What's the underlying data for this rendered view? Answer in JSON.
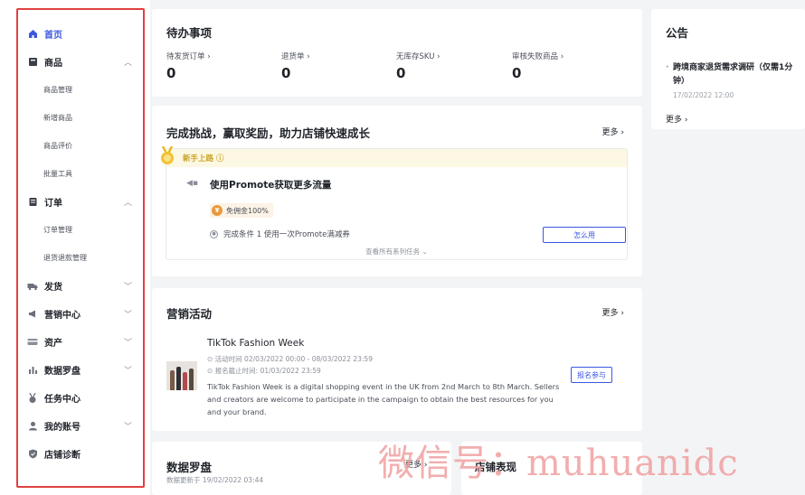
{
  "sidebar": {
    "items": [
      {
        "label": "首页",
        "icon": "home-icon",
        "active": true
      },
      {
        "label": "商品",
        "icon": "product-icon",
        "chevron": "up",
        "children": [
          "商品管理",
          "新增商品",
          "商品评价",
          "批量工具"
        ]
      },
      {
        "label": "订单",
        "icon": "order-icon",
        "chevron": "up",
        "children": [
          "订单管理",
          "退货退款管理"
        ]
      },
      {
        "label": "发货",
        "icon": "truck-icon",
        "chevron": "down"
      },
      {
        "label": "营销中心",
        "icon": "megaphone-icon",
        "chevron": "down"
      },
      {
        "label": "资产",
        "icon": "card-icon",
        "chevron": "down"
      },
      {
        "label": "数据罗盘",
        "icon": "chart-icon",
        "chevron": "down"
      },
      {
        "label": "任务中心",
        "icon": "medal-icon"
      },
      {
        "label": "我的账号",
        "icon": "user-icon",
        "chevron": "down"
      },
      {
        "label": "店铺诊断",
        "icon": "shield-icon"
      }
    ]
  },
  "todo": {
    "title": "待办事项",
    "items": [
      {
        "label": "待发货订单 ›",
        "value": "0"
      },
      {
        "label": "退货单 ›",
        "value": "0"
      },
      {
        "label": "无库存SKU ›",
        "value": "0"
      },
      {
        "label": "审核失败商品 ›",
        "value": "0"
      }
    ]
  },
  "notice": {
    "title": "公告",
    "text": "跨境商家退货需求调研（仅需1分钟）",
    "date": "17/02/2022 12:00",
    "more": "更多 ›"
  },
  "challenge": {
    "title": "完成挑战，赢取奖励，助力店铺快速成长",
    "more": "更多 ›",
    "banner": "新手上路 ⓘ",
    "task_title": "使用Promote获取更多流量",
    "reward": "免佣金100%",
    "condition": "完成条件 1  使用一次Promote满减券",
    "button": "怎么用",
    "view_all": "查看所有系列任务 ⌄"
  },
  "campaign": {
    "title": "营销活动",
    "more": "更多 ›",
    "name": "TikTok Fashion Week",
    "time": "⊙ 活动时间  02/03/2022 00:00 - 08/03/2022 23:59",
    "deadline": "⊙ 报名截止时间: 01/03/2022 23:59",
    "desc": "TikTok Fashion Week is a digital shopping event in the UK from 2nd March to 8th March. Sellers and creators are welcome to participate in the campaign to obtain the best resources for you and your brand.",
    "button": "报名参与"
  },
  "compass": {
    "title": "数据罗盘",
    "updated": "数据更新于 19/02/2022 03:44",
    "more": "更多 ›"
  },
  "shop": {
    "title": "店铺表现"
  },
  "watermark": "微信号：muhuanidc",
  "colors": {
    "accent": "#3d57e0",
    "highlight_border": "#e0413f",
    "banner_bg": "#fdf8e3"
  }
}
